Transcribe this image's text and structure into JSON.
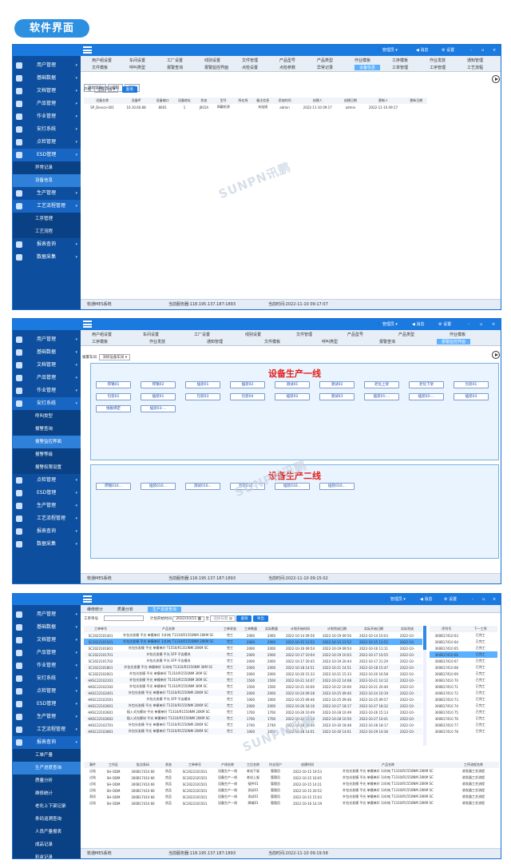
{
  "header": {
    "title": "软件界面"
  },
  "common": {
    "user": "管理员",
    "message": "消息",
    "settings": "设置",
    "footer_system": "软通MES系统",
    "footer_server": "当前服务器:118.195.137.187:1893",
    "minimize": "-",
    "restore": "▫",
    "close": "×"
  },
  "w1": {
    "sidebar": [
      {
        "label": "用户管理",
        "icon": "users-icon"
      },
      {
        "label": "基础数据",
        "icon": "monitor-icon"
      },
      {
        "label": "文档管理",
        "icon": "document-icon"
      },
      {
        "label": "产品管理",
        "icon": "box-icon"
      },
      {
        "label": "作业管理",
        "icon": "briefcase-icon"
      },
      {
        "label": "安灯系统",
        "icon": "bell-icon"
      },
      {
        "label": "点检管理",
        "icon": "check-icon"
      },
      {
        "label": "ESD管理",
        "icon": "shield-icon"
      }
    ],
    "sub_esd": [
      "异常记录",
      "设备信息"
    ],
    "sidebar_after": [
      {
        "label": "生产管理",
        "icon": "cube-icon"
      },
      {
        "label": "工艺流程管理",
        "icon": "share-icon"
      }
    ],
    "sub_flow": [
      "工序管理",
      "工艺流程"
    ],
    "sidebar_end": [
      {
        "label": "报表查询",
        "icon": "report-icon"
      },
      {
        "label": "数据采集",
        "icon": "data-icon"
      }
    ],
    "tabs_row1": [
      "用户组设置",
      "车间设置",
      "工厂设置",
      "线别设置",
      "文件管理",
      "产品型号",
      "产品类型",
      "作业模板",
      "工序模板",
      "作业发放",
      "通知管理"
    ],
    "tabs_row2": [
      "文件模板",
      "呼叫类型",
      "报警查询",
      "报警监控界面",
      "点检设置",
      "点检参数",
      "异常记录",
      "设备信息",
      "工单管理",
      "工序管理",
      "工艺流程"
    ],
    "buttons": {
      "add": "添加设备",
      "edit": "编辑",
      "delete": "删除",
      "search": "查询"
    },
    "filter_label": "产线",
    "filter_value": "全部产线",
    "columns": [
      "设备名称",
      "设备IP",
      "设备端口",
      "设备地址",
      "状态",
      "型号",
      "所在线",
      "备注信息",
      "添加时间",
      "创建人",
      "创建日期",
      "更新人",
      "更新日期"
    ],
    "row": [
      "SP_Device-001",
      "10.10.60.88",
      "8001",
      "1",
      "J001A",
      "佩戴检测",
      "",
      "未连接",
      "admin",
      "2022-11-10 09:17",
      "admin",
      "2022-11-10 09:17"
    ],
    "time": "当前时间:2022-11-10 09:17:07"
  },
  "w2": {
    "sidebar": [
      {
        "label": "用户管理",
        "icon": "users-icon"
      },
      {
        "label": "基础数据",
        "icon": "monitor-icon"
      },
      {
        "label": "文档管理",
        "icon": "document-icon"
      },
      {
        "label": "产品管理",
        "icon": "box-icon"
      },
      {
        "label": "作业管理",
        "icon": "briefcase-icon"
      },
      {
        "label": "安灯系统",
        "icon": "bell-icon"
      }
    ],
    "sub_andon": [
      "呼叫类型",
      "报警查询",
      "报警监控界面",
      "报警等级",
      "报警权限设置"
    ],
    "sidebar_after": [
      {
        "label": "点检管理",
        "icon": "check-icon"
      },
      {
        "label": "ESD管理",
        "icon": "shield-icon"
      },
      {
        "label": "生产管理",
        "icon": "cube-icon"
      },
      {
        "label": "工艺流程管理",
        "icon": "share-icon"
      },
      {
        "label": "报表查询",
        "icon": "report-icon"
      },
      {
        "label": "数据采集",
        "icon": "data-icon"
      }
    ],
    "tabs_row1": [
      "用户组设置",
      "车间设置",
      "工厂设置",
      "线别设置",
      "文件管理",
      "产品型号",
      "产品类型",
      "作业模板"
    ],
    "tabs_row2": [
      "工序模板",
      "作业发放",
      "通知管理",
      "文件模板",
      "呼叫类型",
      "报警查询",
      "报警监控界面"
    ],
    "filter_label": "报警车间",
    "filter_value": "深圳设备车间",
    "line1_title": "设备生产一线",
    "line1_row1": [
      "焊锡01",
      "焊锡02",
      "插装01",
      "插装02",
      "测试01",
      "测试02",
      "老化上架",
      "老化下架",
      "包装01"
    ],
    "line1_row2": [
      "包装02",
      "插装01",
      "包装03",
      "包装04",
      "插装02",
      "测试03",
      "插装01-...",
      "插装02-...",
      "插装03"
    ],
    "line1_row3": [
      "线板绑定",
      "插装03-..."
    ],
    "line2_title": "设备生产二线",
    "line2_row": [
      "焊锡010...",
      "插装010...",
      "测试010...",
      "包装010...",
      "插装010...",
      "插装010..."
    ],
    "time": "当前时间:2022-11-10 09:15:02"
  },
  "w3": {
    "sidebar": [
      {
        "label": "用户管理",
        "icon": "users-icon"
      },
      {
        "label": "基础数据",
        "icon": "monitor-icon"
      },
      {
        "label": "文档管理",
        "icon": "document-icon"
      },
      {
        "label": "产品管理",
        "icon": "box-icon"
      },
      {
        "label": "作业管理",
        "icon": "briefcase-icon"
      },
      {
        "label": "安灯系统",
        "icon": "bell-icon"
      },
      {
        "label": "点检管理",
        "icon": "check-icon"
      },
      {
        "label": "ESD管理",
        "icon": "shield-icon"
      },
      {
        "label": "生产管理",
        "icon": "cube-icon"
      },
      {
        "label": "工艺流程管理",
        "icon": "share-icon"
      },
      {
        "label": "报表查询",
        "icon": "report-icon"
      }
    ],
    "sub_report": [
      "工单产量",
      "生产进度查询",
      "质量分析",
      "维修统计",
      "老化上下架记录",
      "条码追溯查询",
      "人员产量报表",
      "成品记录",
      "彩盒记录"
    ],
    "tabs": [
      "维修统计",
      "质量分析",
      "生产进度查询"
    ],
    "search_label": "工单单号",
    "date_label": "计划开始时间",
    "date_value": "2022/10/11",
    "to": "至",
    "end_placeholder": "选择日期",
    "query": "查询",
    "export": "导出",
    "columns": [
      "工单单号",
      "产品名称",
      "工单状态",
      "工单数量",
      "实际数量",
      "计划开始时间",
      "计划完成日期",
      "实际开始日期",
      "实际完成"
    ],
    "rows": [
      [
        "SC2022101401",
        "外包光发模 平光 单模单纤 1(4)吨 T1310/R1550NM 20KM SC",
        "完工",
        "2060",
        "2060",
        "2022-10-14 09:56",
        "2022-10-19 09:56",
        "2022-10-14 10:03",
        "2022-10-"
      ],
      [
        "SC2022101501",
        "外包光发模 平光 单模单纤 1(4)吨 T1310/R1550NM 20KM SC",
        "完工",
        "2060",
        "2060",
        "2022-10-15 13:52",
        "2022-10-15 13:52",
        "2022-10-15 13:52",
        "2022-10-"
      ],
      [
        "SC2022101601",
        "外包光发模 平光 单模单纤 T1550/R1310NM 20KM SC",
        "完工",
        "2000",
        "2000",
        "2022-10-16 09:54",
        "2022-10-19 09:54",
        "2022-10-16 11:11",
        "2022-10-"
      ],
      [
        "SC2022101701",
        "外包光发模 平光 SFP 不含模块",
        "完工",
        "2000",
        "2000",
        "2022-10-17 10:04",
        "2022-10-19 10:03",
        "2022-10-17 10:55",
        "2022-10-"
      ],
      [
        "SC2022101702",
        "外包光发模 平光 SFP 不含模块",
        "完工",
        "2000",
        "2000",
        "2022-10-17 20:45",
        "2022-10-19 20:44",
        "2022-10-17 21:29",
        "2022-10-"
      ],
      [
        "SC2022101801",
        "外包光发模 平光 单模单纤 1(4)吨 T1310/R1550NM 3KM SC",
        "完工",
        "2000",
        "2000",
        "2022-10-18 14:51",
        "2022-10-21 14:51",
        "2022-10-18 15:47",
        "2022-10-"
      ],
      [
        "SC2022102001",
        "外包光发模 平光 单模单纤 T1310/R1550NM 3KM SC",
        "完工",
        "2000",
        "2000",
        "2022-10-20 15:33",
        "2022-10-21 15:33",
        "2022-10-20 16:58",
        "2022-10-"
      ],
      [
        "HKSC22102101",
        "外包光发模 平光 单模单纤 T1310/R1550NM 3KM SC",
        "完工",
        "1500",
        "1500",
        "2022-10-21 14:07",
        "2022-10-22 14:08",
        "2022-10-21 14:12",
        "2022-10-"
      ],
      [
        "HKSC22102102",
        "外包光发模 平光 单模单纤 T1310/R1550NM 3KM SC",
        "完工",
        "1500",
        "1500",
        "2022-10-21 16:00",
        "2022-10-22 16:00",
        "2022-10-21 20:40",
        "2022-10-"
      ],
      [
        "HKSC22102401",
        "外包光发模 平光 单模单纤 T1310/R1550NM 20KM SC",
        "完工",
        "2000",
        "2000",
        "2022-10-24 09:38",
        "2022-10-25 09:40",
        "2022-10-24 10:19",
        "2022-10-"
      ],
      [
        "HKSC22102501",
        "外包光发模 平光 SFP 不含模块",
        "完工",
        "1000",
        "1000",
        "2022-10-25 09:46",
        "2022-10-25 09:46",
        "2022-10-25 09:57",
        "2022-10-"
      ],
      [
        "HKSC22102601",
        "外包光发模 平光 单模单纤 T1310/R1550NM 20KM SC",
        "完工",
        "2000",
        "2000",
        "2022-10-26 18:16",
        "2022-10-27 18:17",
        "2022-10-27 18:32",
        "2022-10-"
      ],
      [
        "HKSC22102601",
        "插入式光模块 平光 单模单纤 T1310/R1550NM 20KM SC",
        "完工",
        "1700",
        "1700",
        "2022-10-26 10:49",
        "2022-10-28 10:49",
        "2022-10-26 15:13",
        "2022-10-"
      ],
      [
        "HKSC22102602",
        "插入式光模块 平光 单模单纤 T1310/R1550NM 20KM SC",
        "完工",
        "1700",
        "1700",
        "2022-10-26 10:50",
        "2022-10-28 10:50",
        "2022-10-27 10:41",
        "2022-10-"
      ],
      [
        "HKSC22102701",
        "外包光发模 平光 单模单纤 T1310/R1550NM 20KM SC",
        "完工",
        "2740",
        "2740",
        "2022-10-28 18:46",
        "2022-10-30 18:48",
        "2022-10-28 18:17",
        "2022-10-"
      ],
      [
        "HKSC22102801",
        "外包光发模 平光 单模单纤 T1310/R1550NM 20KM SC",
        "完工",
        "1000",
        "1000",
        "2022-10-28 14:01",
        "2022-10-30 14:01",
        "2022-10-29 14:36",
        "2022-10-"
      ]
    ],
    "right_columns": [
      "序列号",
      "下一工序"
    ],
    "right_rows": [
      [
        "300B17410 63",
        "已完工"
      ],
      [
        "300B17410 64",
        "已完工"
      ],
      [
        "300B17410 65",
        "已完工"
      ],
      [
        "300B17410 66",
        "已完工"
      ],
      [
        "300B17410 67",
        "已完工"
      ],
      [
        "300B17410 68",
        "已完工"
      ],
      [
        "300B17410 69",
        "已完工"
      ],
      [
        "300B17410 70",
        "已完工"
      ],
      [
        "300B17410 71",
        "已完工"
      ],
      [
        "300B17410 72",
        "已完工"
      ],
      [
        "300B17410 73",
        "已完工"
      ],
      [
        "300B17410 74",
        "已完工"
      ],
      [
        "300B17410 75",
        "已完工"
      ],
      [
        "300B17410 76",
        "已完工"
      ],
      [
        "300B17410 77",
        "已完工"
      ],
      [
        "300B17410 78",
        "已完工"
      ]
    ],
    "bottom_columns": [
      "事件",
      "工作区",
      "批次条码",
      "状态",
      "工单单号",
      "产线名称",
      "工位名称",
      "作业用户",
      "创建时间",
      "产品名称",
      "工序流程名称"
    ],
    "bottom_rows": [
      [
        "过站",
        "SH-ODM",
        "300B17410 66",
        "良品",
        "SC2022101501",
        "设备生产一线",
        "老化下架",
        "管理员",
        "2022-10-15 19:53",
        "外包光发模 平光 单模单纤 1(4)吨 T1310/R1550NM 20KM SC",
        "收发器工艺流程"
      ],
      [
        "过站",
        "SH-ODM",
        "300B17410 66",
        "良品",
        "SC2022101501",
        "设备生产一线",
        "老化上架",
        "管理员",
        "2022-10-15 16:05",
        "外包光发模 平光 单模单纤 1(4)吨 T1310/R1550NM 20KM SC",
        "收发器工艺流程"
      ],
      [
        "过站",
        "SH-ODM",
        "300B17410 66",
        "良品",
        "SC2022101501",
        "设备生产一线",
        "插件01",
        "管理员",
        "2022-10-15 14:21",
        "外包光发模 平光 单模单纤 1(4)吨 T1310/R1550NM 20KM SC",
        "收发器工艺流程"
      ],
      [
        "过站",
        "SH-ODM",
        "300B17410 66",
        "良品",
        "SC2022101501",
        "设备生产一线",
        "测试01",
        "管理员",
        "2022-10-15 20:52",
        "外包光发模 平光 单模单纤 1(4)吨 T1310/R1550NM 20KM SC",
        "收发器工艺流程"
      ],
      [
        "测试",
        "SH-ODM",
        "300B17410 66",
        "良品",
        "SC2022101501",
        "设备生产一线",
        "测试01",
        "管理员",
        "2022-10-15 15:03",
        "外包光发模 平光 单模单纤 1(4)吨 T1310/R1550NM 20KM SC",
        "收发器工艺流程"
      ],
      [
        "过站",
        "SH-ODM",
        "300B17410 66",
        "良品",
        "SC2022101501",
        "设备生产一线",
        "焊锡01",
        "管理员",
        "2022-10-16 14:19",
        "外包光发模 平光 单模单纤 1(4)吨 T1310/R1550NM 20KM SC",
        "收发器工艺流程"
      ]
    ],
    "time": "当前时间:2022-11-10 09:19:58"
  }
}
